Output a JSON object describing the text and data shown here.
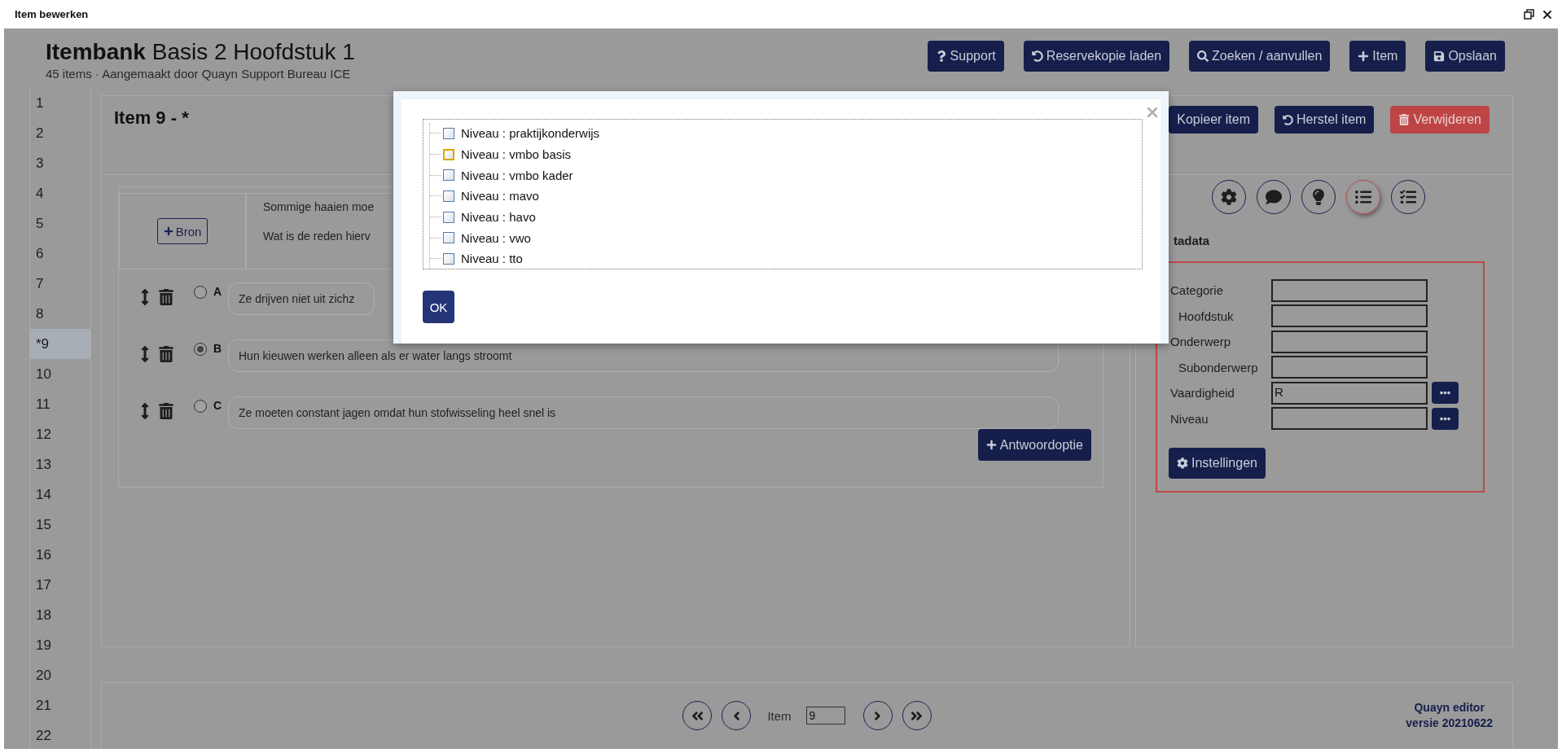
{
  "window": {
    "title": "Item bewerken"
  },
  "header": {
    "title_bold": "Itembank",
    "title": "Basis 2 Hoofdstuk 1",
    "subtitle": "45 items · Aangemaakt door Quayn Support Bureau ICE"
  },
  "toolbar": [
    "Support",
    "Reservekopie laden",
    "Zoeken / aanvullen",
    "Item",
    "Opslaan"
  ],
  "item_list": [
    {
      "label": "1",
      "selected": false
    },
    {
      "label": "2",
      "selected": false
    },
    {
      "label": "3",
      "selected": false
    },
    {
      "label": "4",
      "selected": false
    },
    {
      "label": "5",
      "selected": false
    },
    {
      "label": "6",
      "selected": false
    },
    {
      "label": "7",
      "selected": false
    },
    {
      "label": "8",
      "selected": false
    },
    {
      "label": "*9",
      "selected": true
    },
    {
      "label": "10",
      "selected": false
    },
    {
      "label": "11",
      "selected": false
    },
    {
      "label": "12",
      "selected": false
    },
    {
      "label": "13",
      "selected": false
    },
    {
      "label": "14",
      "selected": false
    },
    {
      "label": "15",
      "selected": false
    },
    {
      "label": "16",
      "selected": false
    },
    {
      "label": "17",
      "selected": false
    },
    {
      "label": "18",
      "selected": false
    },
    {
      "label": "19",
      "selected": false
    },
    {
      "label": "20",
      "selected": false
    },
    {
      "label": "21",
      "selected": false
    },
    {
      "label": "22",
      "selected": false
    }
  ],
  "item": {
    "title": "Item 9 - *",
    "actions": [
      {
        "label": "Kopieer item",
        "kind": "primary"
      },
      {
        "label": "Herstel item",
        "kind": "primary"
      },
      {
        "label": "Verwijderen",
        "kind": "danger"
      }
    ]
  },
  "question": {
    "source_button": "Bron",
    "text_lines": [
      "Sommige haaien moe",
      "Wat is de reden hierv"
    ]
  },
  "answers": [
    {
      "letter": "A",
      "text": "Ze drijven niet uit zichz",
      "selected": false
    },
    {
      "letter": "B",
      "text": "Hun kieuwen werken alleen als er water langs stroomt",
      "selected": true
    },
    {
      "letter": "C",
      "text": "Ze moeten constant jagen omdat hun stofwisseling heel snel is",
      "selected": false
    }
  ],
  "add_answer": "Antwoordoptie",
  "panel_tabs": [
    {
      "selected": false
    },
    {
      "selected": false
    },
    {
      "selected": false
    },
    {
      "selected": true
    },
    {
      "selected": false
    }
  ],
  "metadata": {
    "heading": "tadata",
    "fields": [
      {
        "label": "Categorie",
        "indented": false,
        "picker": false
      },
      {
        "label": "Hoofdstuk",
        "indented": true,
        "picker": false
      },
      {
        "label": "Onderwerp",
        "indented": false,
        "picker": false
      },
      {
        "label": "Subonderwerp",
        "indented": true,
        "picker": false
      },
      {
        "label": "Vaardigheid",
        "value": "R",
        "indented": false,
        "picker": true
      },
      {
        "label": "Niveau",
        "indented": false,
        "picker": true
      }
    ],
    "settings_button": "Instellingen"
  },
  "pager": {
    "label": "Item",
    "value": "9"
  },
  "footer": {
    "lines": [
      "Quayn editor",
      "versie 20210622"
    ]
  },
  "dialog": {
    "options": [
      {
        "label": "Niveau : praktijkonderwijs",
        "checked": false,
        "focused": false
      },
      {
        "label": "Niveau : vmbo basis",
        "checked": false,
        "focused": true
      },
      {
        "label": "Niveau : vmbo kader",
        "checked": false,
        "focused": false
      },
      {
        "label": "Niveau : mavo",
        "checked": false,
        "focused": false
      },
      {
        "label": "Niveau : havo",
        "checked": false,
        "focused": false
      },
      {
        "label": "Niveau : vwo",
        "checked": false,
        "focused": false
      },
      {
        "label": "Niveau : tto",
        "checked": false,
        "focused": false
      }
    ],
    "ok": "OK"
  }
}
